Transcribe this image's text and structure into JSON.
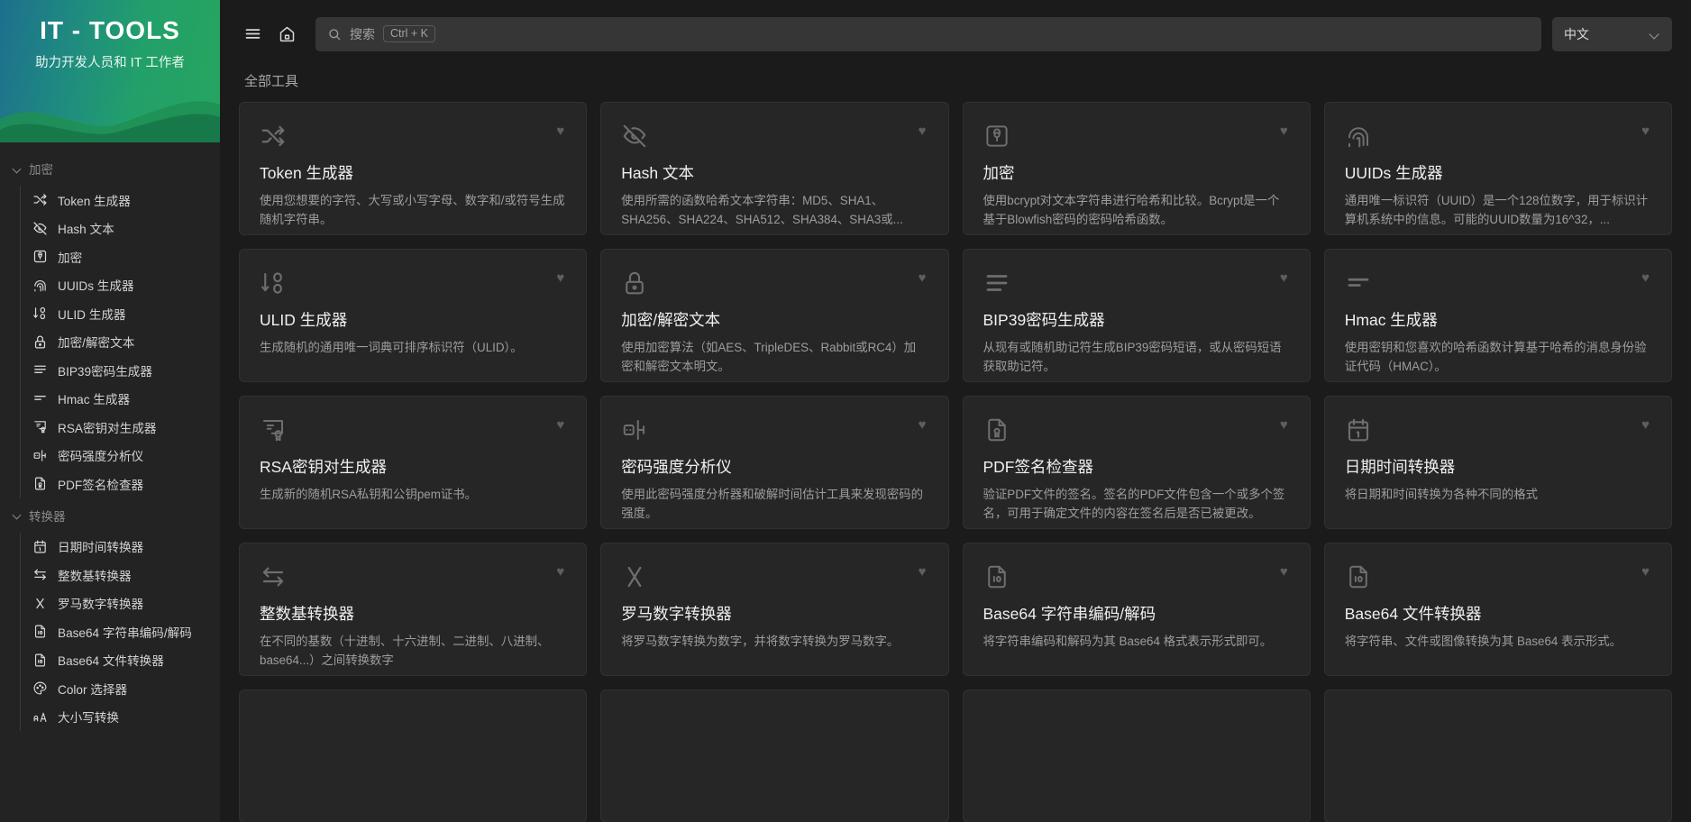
{
  "brand": {
    "title": "IT - TOOLS",
    "subtitle": "助力开发人员和 IT 工作者"
  },
  "colors": {
    "brand_gradient_start": "#1d6f8e",
    "brand_gradient_end": "#27a55f",
    "page_bg": "#1b1b1b",
    "sidebar_bg": "#232323",
    "card_bg": "#262626",
    "card_border": "#313131",
    "input_bg": "#363636"
  },
  "topbar": {
    "menu_icon": "hamburger-menu-icon",
    "home_icon": "home-icon",
    "search": {
      "icon": "search-icon",
      "placeholder": "搜索",
      "shortcut": "Ctrl + K",
      "value": ""
    },
    "language": {
      "selected": "中文",
      "chevron": "chevron-down-icon"
    }
  },
  "sidebar": {
    "groups": [
      {
        "label": "加密",
        "items": [
          {
            "label": "Token 生成器",
            "icon": "shuffle-icon"
          },
          {
            "label": "Hash 文本",
            "icon": "eye-off-icon"
          },
          {
            "label": "加密",
            "icon": "lock-square-icon"
          },
          {
            "label": "UUIDs 生成器",
            "icon": "fingerprint-icon"
          },
          {
            "label": "ULID 生成器",
            "icon": "sort-descending-numbers-icon"
          },
          {
            "label": "加密/解密文本",
            "icon": "lock-icon"
          },
          {
            "label": "BIP39密码生成器",
            "icon": "list-lines-icon"
          },
          {
            "label": "Hmac 生成器",
            "icon": "align-left-lines-icon"
          },
          {
            "label": "RSA密钥对生成器",
            "icon": "certificate-icon"
          },
          {
            "label": "密码强度分析仪",
            "icon": "password-meter-icon"
          },
          {
            "label": "PDF签名检查器",
            "icon": "file-signature-icon"
          }
        ]
      },
      {
        "label": "转换器",
        "items": [
          {
            "label": "日期时间转换器",
            "icon": "calendar-icon"
          },
          {
            "label": "整数基转换器",
            "icon": "arrows-exchange-icon"
          },
          {
            "label": "罗马数字转换器",
            "icon": "roman-x-icon"
          },
          {
            "label": "Base64 字符串编码/解码",
            "icon": "file-binary-icon"
          },
          {
            "label": "Base64 文件转换器",
            "icon": "file-binary-icon"
          },
          {
            "label": "Color 选择器",
            "icon": "palette-icon"
          },
          {
            "label": "大小写转换",
            "icon": "letter-case-icon"
          }
        ]
      }
    ]
  },
  "main": {
    "section_title": "全部工具",
    "favorite_icon": "heart-icon",
    "tools": [
      {
        "title": "Token 生成器",
        "desc": "使用您想要的字符、大写或小写字母、数字和/或符号生成随机字符串。",
        "icon": "shuffle-icon"
      },
      {
        "title": "Hash 文本",
        "desc": "使用所需的函数哈希文本字符串：MD5、SHA1、SHA256、SHA224、SHA512、SHA384、SHA3或...",
        "icon": "eye-off-icon"
      },
      {
        "title": "加密",
        "desc": "使用bcrypt对文本字符串进行哈希和比较。Bcrypt是一个基于Blowfish密码的密码哈希函数。",
        "icon": "lock-square-icon"
      },
      {
        "title": "UUIDs 生成器",
        "desc": "通用唯一标识符（UUID）是一个128位数字，用于标识计算机系统中的信息。可能的UUID数量为16^32，...",
        "icon": "fingerprint-icon"
      },
      {
        "title": "ULID 生成器",
        "desc": "生成随机的通用唯一词典可排序标识符（ULID）。",
        "icon": "sort-descending-numbers-icon"
      },
      {
        "title": "加密/解密文本",
        "desc": "使用加密算法（如AES、TripleDES、Rabbit或RC4）加密和解密文本明文。",
        "icon": "lock-icon"
      },
      {
        "title": "BIP39密码生成器",
        "desc": "从现有或随机助记符生成BIP39密码短语，或从密码短语获取助记符。",
        "icon": "list-lines-icon"
      },
      {
        "title": "Hmac 生成器",
        "desc": "使用密钥和您喜欢的哈希函数计算基于哈希的消息身份验证代码（HMAC）。",
        "icon": "align-left-lines-icon"
      },
      {
        "title": "RSA密钥对生成器",
        "desc": "生成新的随机RSA私钥和公钥pem证书。",
        "icon": "certificate-icon"
      },
      {
        "title": "密码强度分析仪",
        "desc": "使用此密码强度分析器和破解时间估计工具来发现密码的强度。",
        "icon": "password-meter-icon"
      },
      {
        "title": "PDF签名检查器",
        "desc": "验证PDF文件的签名。签名的PDF文件包含一个或多个签名，可用于确定文件的内容在签名后是否已被更改。",
        "icon": "file-signature-icon"
      },
      {
        "title": "日期时间转换器",
        "desc": "将日期和时间转换为各种不同的格式",
        "icon": "calendar-icon"
      },
      {
        "title": "整数基转换器",
        "desc": "在不同的基数（十进制、十六进制、二进制、八进制、base64...）之间转换数字",
        "icon": "arrows-exchange-icon"
      },
      {
        "title": "罗马数字转换器",
        "desc": "将罗马数字转换为数字，并将数字转换为罗马数字。",
        "icon": "roman-x-icon"
      },
      {
        "title": "Base64 字符串编码/解码",
        "desc": "将字符串编码和解码为其 Base64 格式表示形式即可。",
        "icon": "file-binary-icon"
      },
      {
        "title": "Base64 文件转换器",
        "desc": "将字符串、文件或图像转换为其 Base64 表示形式。",
        "icon": "file-binary-icon"
      }
    ]
  }
}
